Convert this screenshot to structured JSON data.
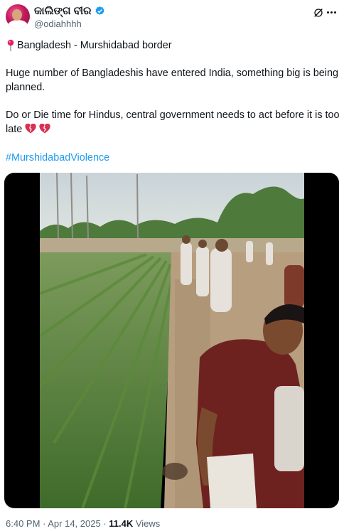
{
  "post": {
    "display_name": "କାଲିଙ୍ଗ ବୀର",
    "handle": "@odiahhhh",
    "location_line": "Bangladesh - Murshidabad border",
    "paragraph1": "Huge number of Bangladeshis have entered India, something big is being planned.",
    "paragraph2": "Do or Die time for Hindus, central government needs to act before it is too late",
    "hashtag": "#MurshidabadViolence"
  },
  "meta": {
    "time": "6:40 PM · Apr 14, 2025 · ",
    "views_count": "11.4K",
    "views_label": " Views"
  },
  "icons": {
    "verified": "verified-badge-icon",
    "grok": "grok-icon",
    "more": "more-icon",
    "location_pin": "round-pushpin-icon",
    "broken_heart": "broken-heart-icon"
  },
  "colors": {
    "accent": "#1d9bf0",
    "secondary_text": "#536471",
    "primary_text": "#0f1419"
  }
}
